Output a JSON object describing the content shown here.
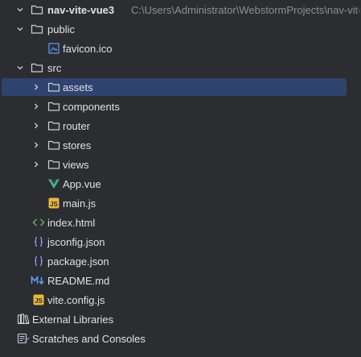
{
  "project": {
    "root_name": "nav-vite-vue3",
    "root_path": "C:\\Users\\Administrator\\WebstormProjects\\nav-vite-vu"
  },
  "tree": {
    "public": {
      "label": "public",
      "favicon": "favicon.ico"
    },
    "src": {
      "label": "src",
      "assets": "assets",
      "components": "components",
      "router": "router",
      "stores": "stores",
      "views": "views",
      "app_vue": "App.vue",
      "main_js": "main.js"
    },
    "files": {
      "index_html": "index.html",
      "jsconfig": "jsconfig.json",
      "package": "package.json",
      "readme": "README.md",
      "vite_config": "vite.config.js"
    },
    "external_libraries": "External Libraries",
    "scratches": "Scratches and Consoles"
  },
  "colors": {
    "background": "#2b2d30",
    "selection": "#2e436e",
    "text": "#dfe1e5",
    "path_text": "#8c8f94",
    "vue_green": "#42b883",
    "js_yellow": "#e8b739",
    "json_purple": "#a78bfa",
    "html_green": "#6aab73",
    "markdown_blue": "#5f9cf5"
  },
  "icons": {
    "folder": "folder-icon",
    "image_file": "image-file-icon",
    "vue_file": "vue-file-icon",
    "js_file": "js-file-icon",
    "html_file": "html-file-icon",
    "json_file": "json-file-icon",
    "markdown_file": "markdown-file-icon",
    "library": "library-icon",
    "scratches": "scratches-icon"
  }
}
